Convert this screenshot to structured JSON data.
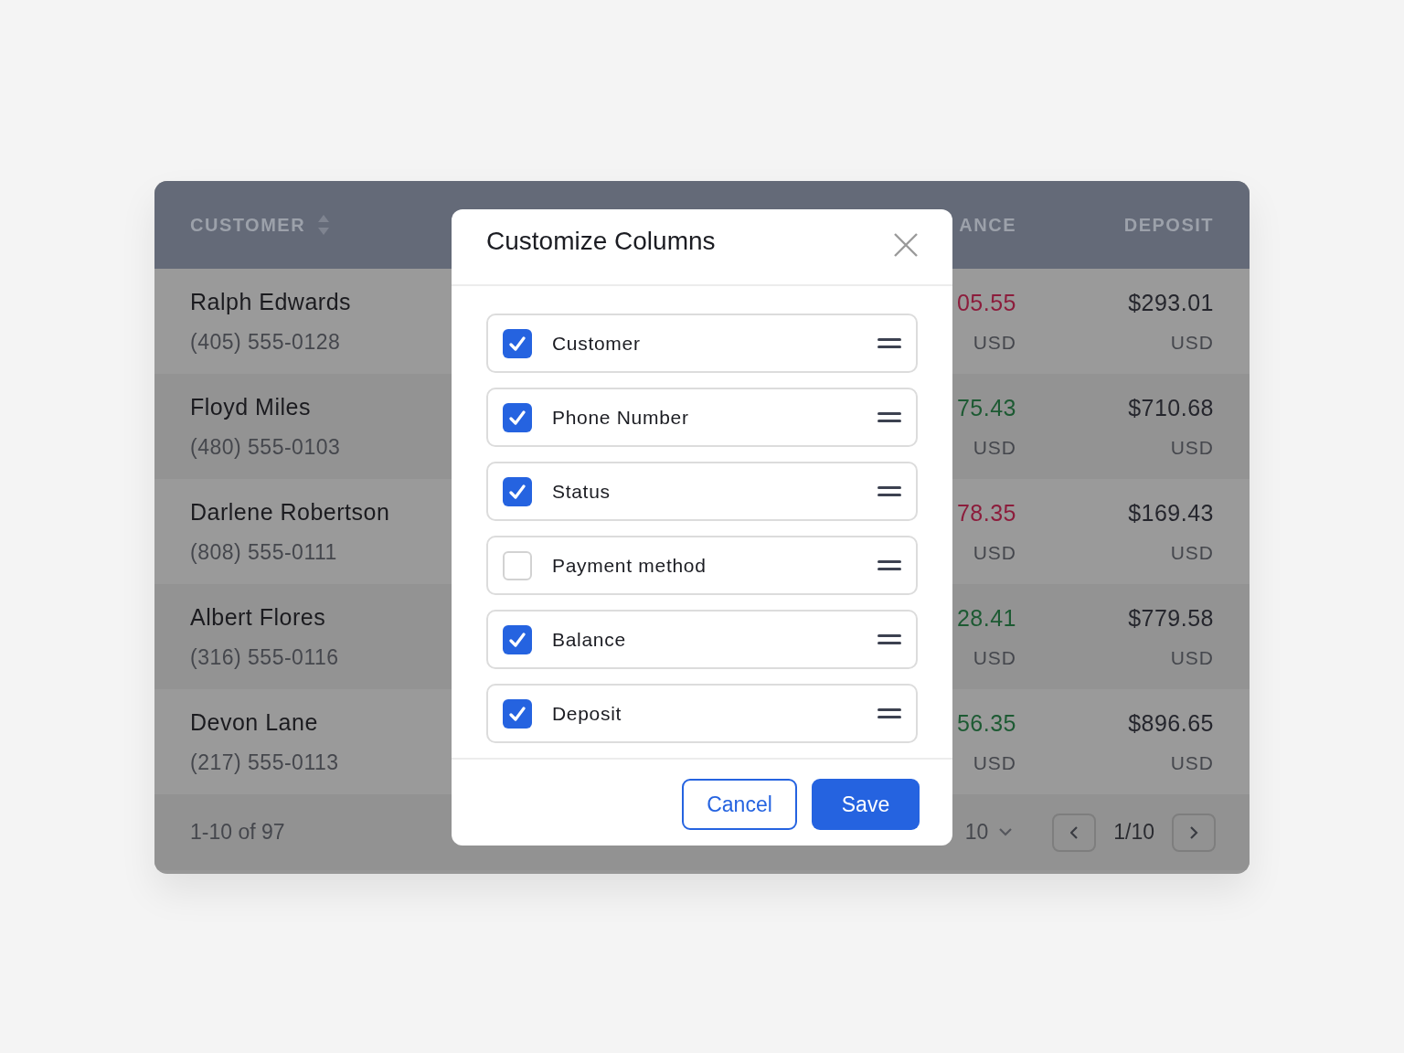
{
  "table": {
    "columns": [
      {
        "label": "CUSTOMER"
      },
      {
        "label": "ANCE"
      },
      {
        "label": "DEPOSIT"
      }
    ],
    "rows": [
      {
        "name": "Ralph Edwards",
        "phone": "(405) 555-0128",
        "balance": "05.55",
        "color": "#8c1d3c",
        "balance_currency": "USD",
        "deposit": "$293.01",
        "deposit_currency": "USD"
      },
      {
        "name": "Floyd Miles",
        "phone": "(480) 555-0103",
        "balance": "75.43",
        "color": "#1d5a33",
        "balance_currency": "USD",
        "deposit": "$710.68",
        "deposit_currency": "USD"
      },
      {
        "name": "Darlene Robertson",
        "phone": "(808) 555-0111",
        "balance": "78.35",
        "color": "#8c1d3c",
        "balance_currency": "USD",
        "deposit": "$169.43",
        "deposit_currency": "USD"
      },
      {
        "name": "Albert Flores",
        "phone": "(316) 555-0116",
        "balance": "28.41",
        "color": "#1d5a33",
        "balance_currency": "USD",
        "deposit": "$779.58",
        "deposit_currency": "USD"
      },
      {
        "name": "Devon Lane",
        "phone": "(217) 555-0113",
        "balance": "56.35",
        "color": "#1d5a33",
        "balance_currency": "USD",
        "deposit": "$896.65",
        "deposit_currency": "USD"
      }
    ],
    "footer": {
      "range": "1-10 of 97",
      "page_size": "10",
      "page": "1/10"
    }
  },
  "dialog": {
    "title": "Customize Columns",
    "columns": [
      {
        "label": "Customer",
        "checked": true
      },
      {
        "label": "Phone Number",
        "checked": true
      },
      {
        "label": "Status",
        "checked": true
      },
      {
        "label": "Payment method",
        "checked": false
      },
      {
        "label": "Balance",
        "checked": true
      },
      {
        "label": "Deposit",
        "checked": true
      }
    ],
    "buttons": {
      "cancel": "Cancel",
      "save": "Save"
    }
  }
}
